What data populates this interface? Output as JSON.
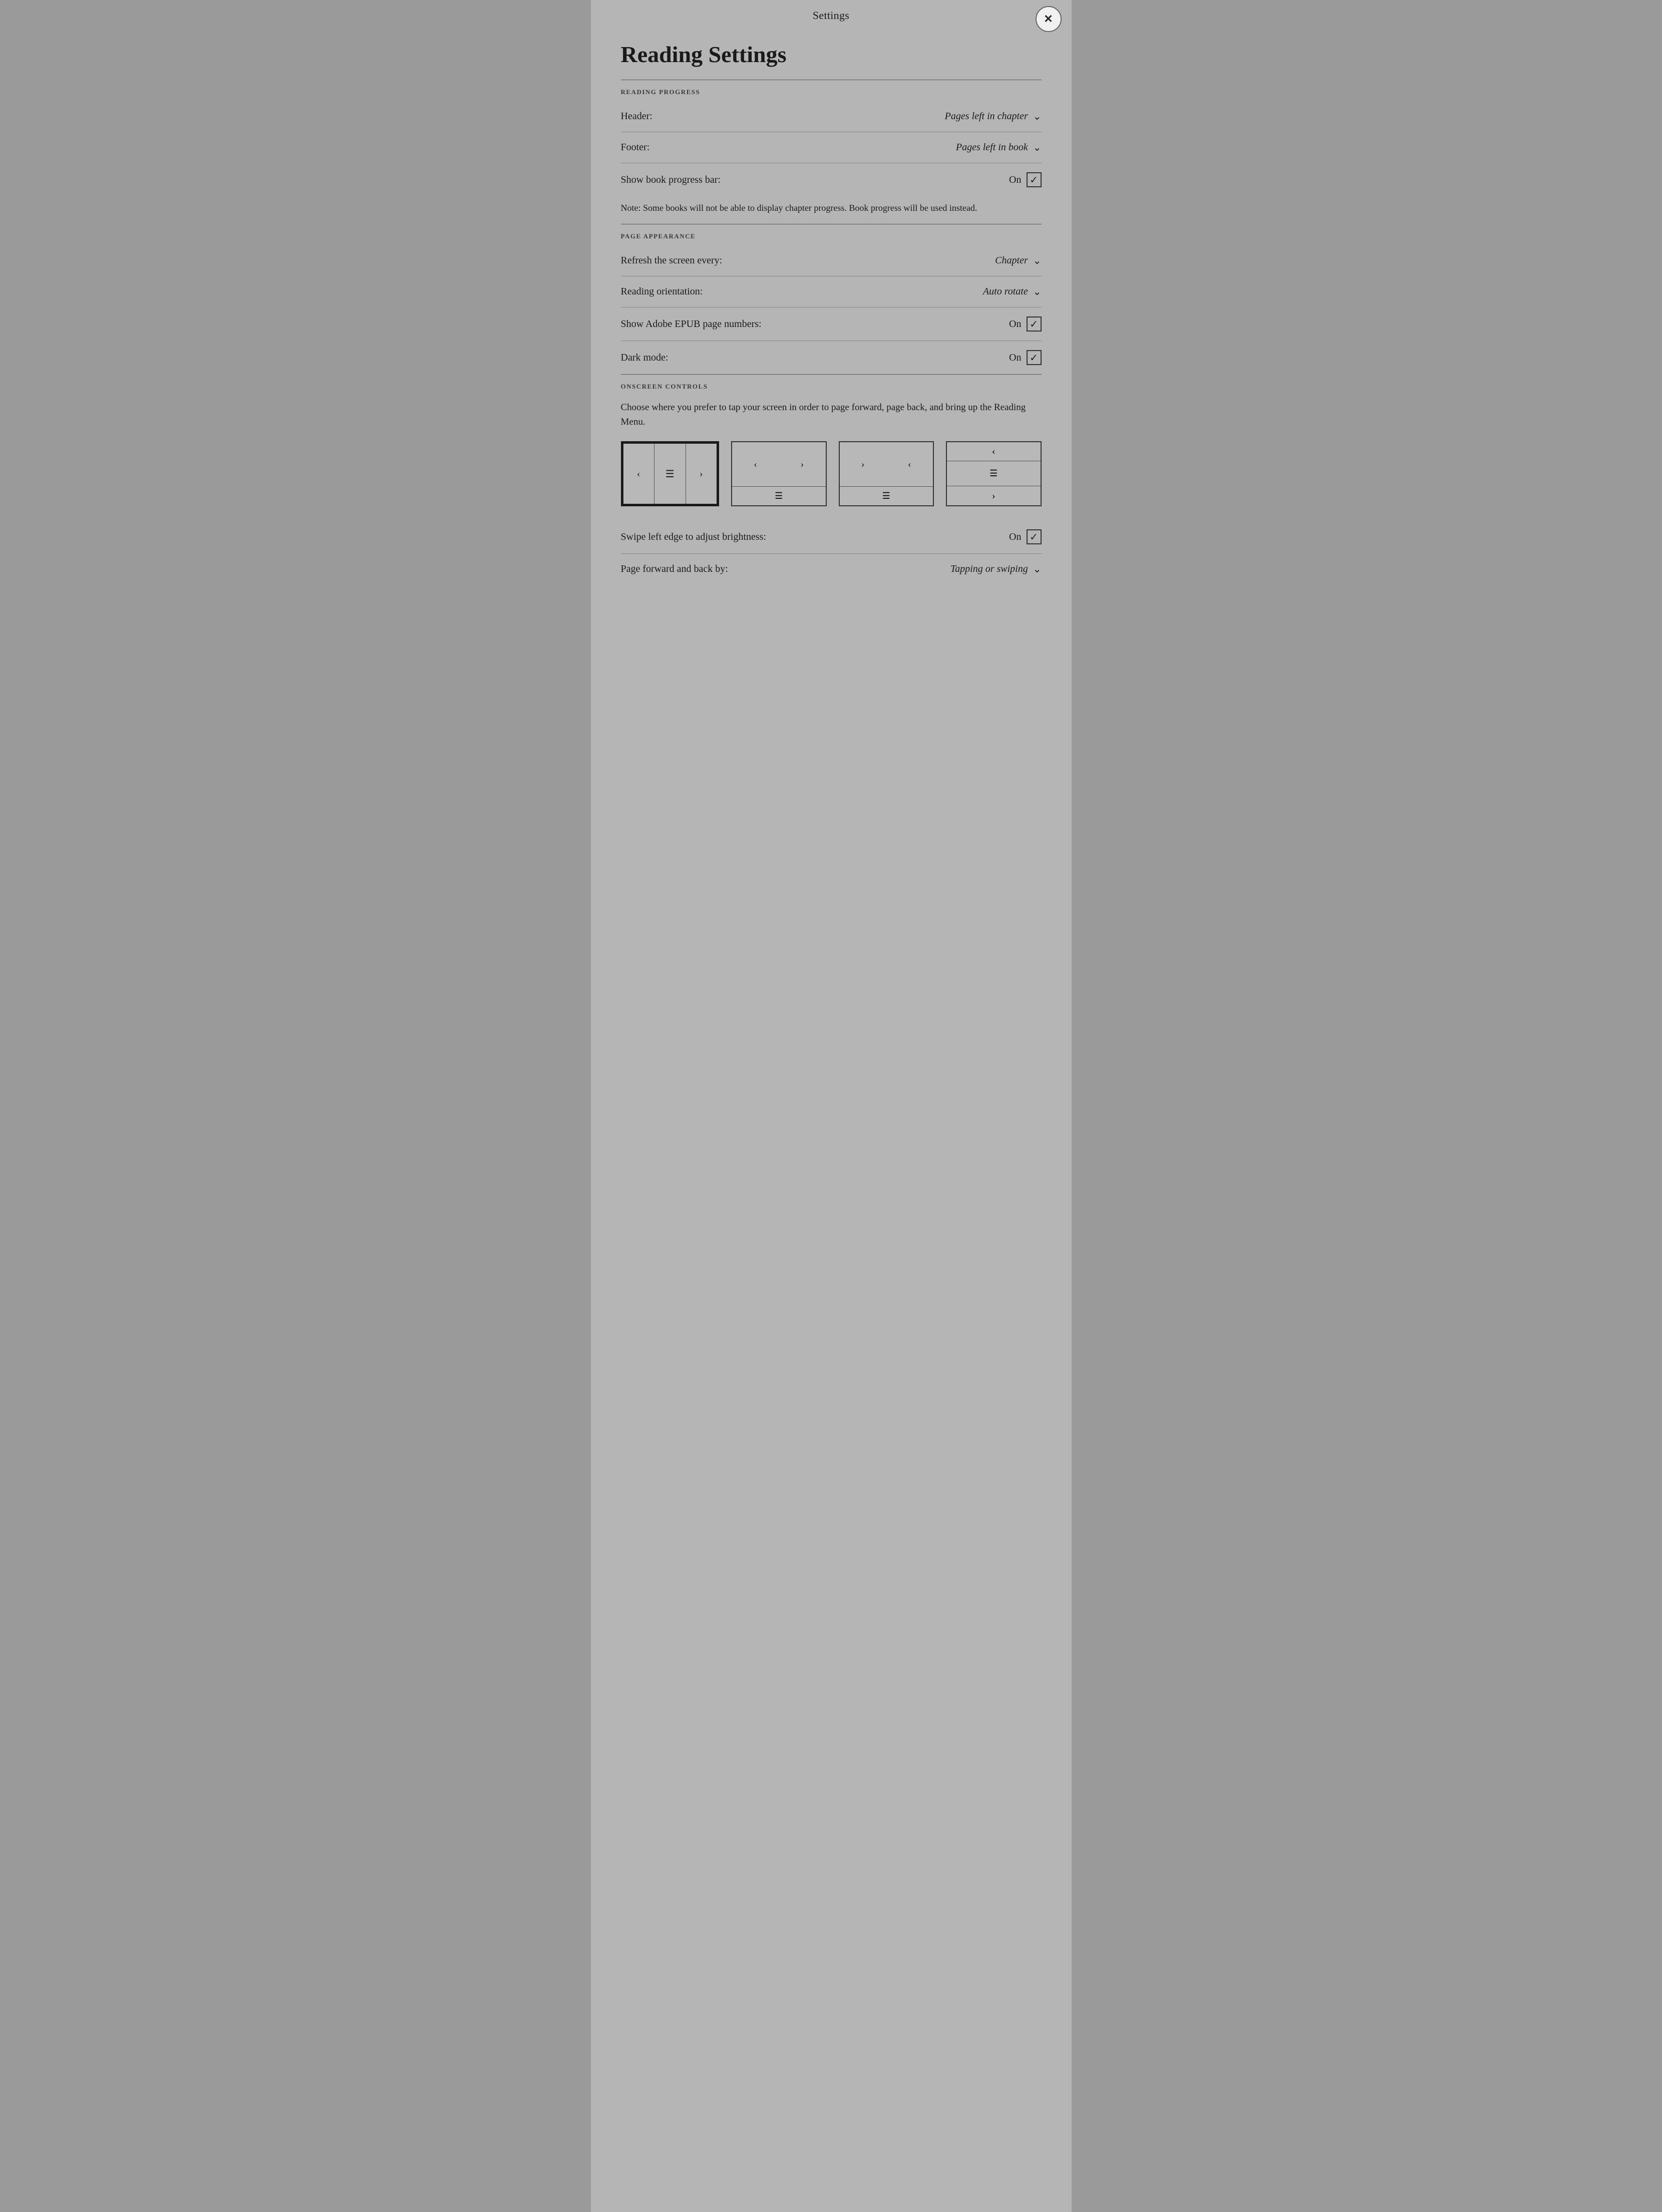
{
  "modal": {
    "title": "Settings",
    "close_label": "✕"
  },
  "page": {
    "heading": "Reading Settings"
  },
  "sections": {
    "reading_progress": {
      "label": "READING PROGRESS",
      "header_label": "Header:",
      "header_value": "Pages left in chapter",
      "footer_label": "Footer:",
      "footer_value": "Pages left in book",
      "show_progress_label": "Show book progress bar:",
      "show_progress_state": "On",
      "show_progress_checked": true,
      "note": "Note: Some books will not be able to display chapter progress. Book progress will be used instead."
    },
    "page_appearance": {
      "label": "PAGE APPEARANCE",
      "refresh_label": "Refresh the screen every:",
      "refresh_value": "Chapter",
      "orientation_label": "Reading orientation:",
      "orientation_value": "Auto rotate",
      "adobe_label": "Show Adobe EPUB page numbers:",
      "adobe_state": "On",
      "adobe_checked": true,
      "dark_label": "Dark mode:",
      "dark_state": "On",
      "dark_checked": true
    },
    "onscreen_controls": {
      "label": "ONSCREEN CONTROLS",
      "description": "Choose where you prefer to tap your screen in order to page forward, page back, and bring up the Reading Menu.",
      "options": [
        {
          "id": "option1",
          "selected": true
        },
        {
          "id": "option2",
          "selected": false
        },
        {
          "id": "option3",
          "selected": false
        },
        {
          "id": "option4",
          "selected": false
        }
      ],
      "swipe_label": "Swipe left edge to adjust brightness:",
      "swipe_state": "On",
      "swipe_checked": true,
      "page_forward_label": "Page forward and back by:",
      "page_forward_value": "Tapping or swiping"
    }
  }
}
